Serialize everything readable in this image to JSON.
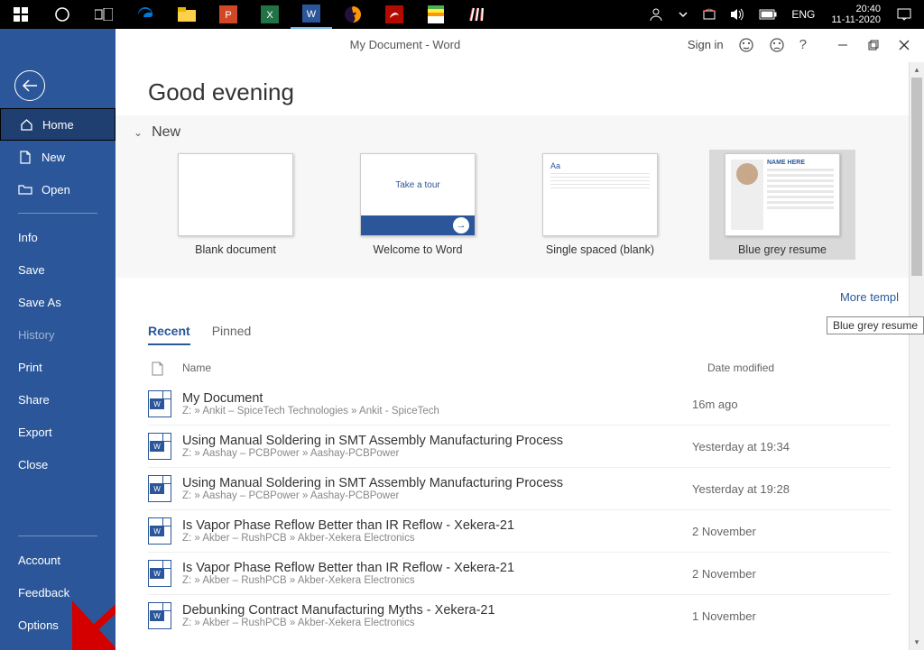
{
  "taskbar": {
    "clock_time": "20:40",
    "clock_date": "11-11-2020",
    "lang": "ENG"
  },
  "titlebar": {
    "document_title": "My Document  -  Word",
    "signin": "Sign in"
  },
  "sidebar": {
    "home": "Home",
    "new": "New",
    "open": "Open",
    "info": "Info",
    "save": "Save",
    "saveas": "Save As",
    "history": "History",
    "print": "Print",
    "share": "Share",
    "export": "Export",
    "close": "Close",
    "account": "Account",
    "feedback": "Feedback",
    "options": "Options"
  },
  "greeting": "Good evening",
  "new_section": {
    "heading": "New",
    "templates": {
      "blank": "Blank document",
      "welcome": "Welcome to Word",
      "welcome_thumb_text": "Take a tour",
      "single": "Single spaced (blank)",
      "single_aa": "Aa",
      "resume": "Blue grey resume",
      "resume_name": "NAME HERE"
    },
    "tooltip": "Blue grey resume",
    "more_link": "More templ"
  },
  "tabs": {
    "recent": "Recent",
    "pinned": "Pinned"
  },
  "list_head": {
    "name": "Name",
    "date": "Date modified",
    "icon_placeholder": ""
  },
  "docs": [
    {
      "title": "My Document",
      "path": "Z: » Ankit – SpiceTech Technologies » Ankit - SpiceTech",
      "date": "16m ago"
    },
    {
      "title": "Using Manual Soldering in SMT Assembly Manufacturing Process",
      "path": "Z: » Aashay – PCBPower » Aashay-PCBPower",
      "date": "Yesterday at 19:34"
    },
    {
      "title": "Using Manual Soldering in SMT Assembly Manufacturing Process",
      "path": "Z: » Aashay – PCBPower » Aashay-PCBPower",
      "date": "Yesterday at 19:28"
    },
    {
      "title": "Is Vapor Phase Reflow Better than IR Reflow - Xekera-21",
      "path": "Z: » Akber – RushPCB » Akber-Xekera Electronics",
      "date": "2 November"
    },
    {
      "title": "Is Vapor Phase Reflow Better than IR Reflow - Xekera-21",
      "path": "Z: » Akber – RushPCB » Akber-Xekera Electronics",
      "date": "2 November"
    },
    {
      "title": "Debunking Contract Manufacturing Myths - Xekera-21",
      "path": "Z: » Akber – RushPCB » Akber-Xekera Electronics",
      "date": "1 November"
    }
  ]
}
